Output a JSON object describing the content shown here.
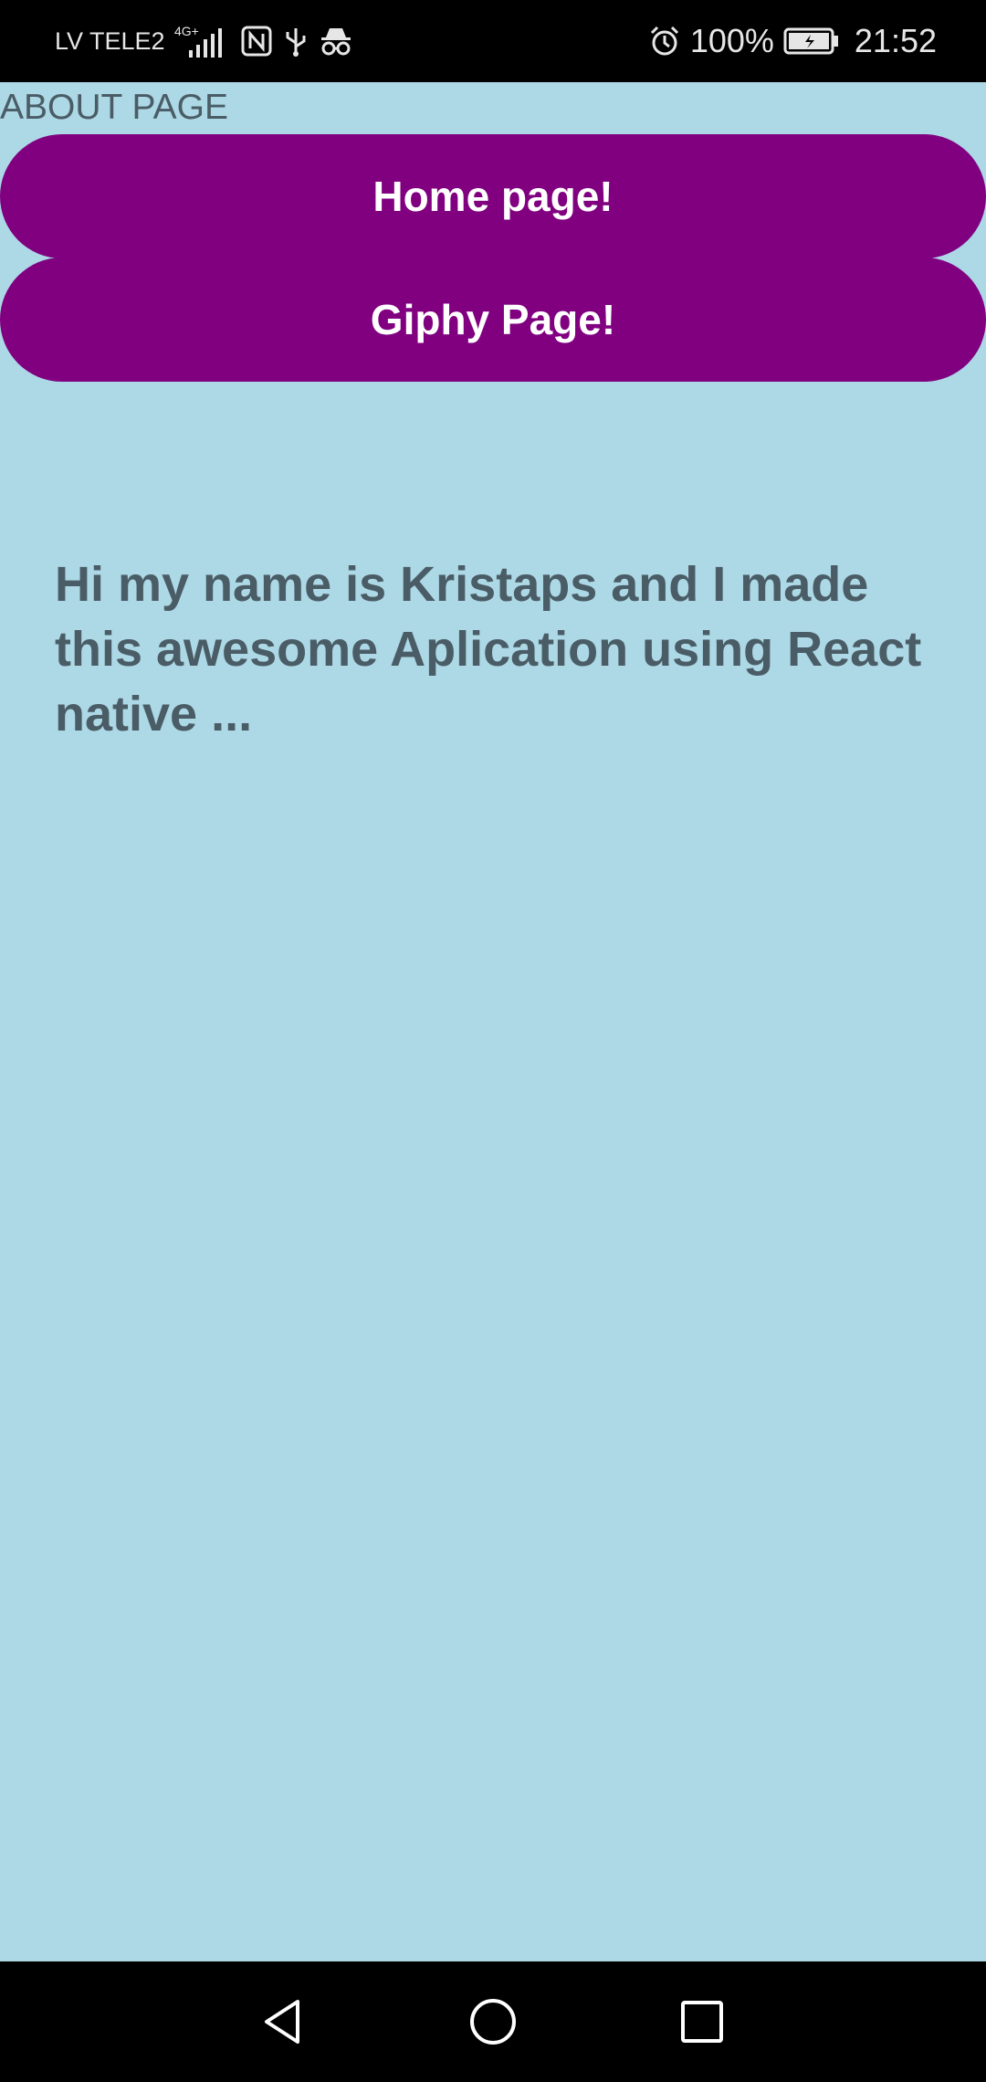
{
  "status_bar": {
    "carrier": "LV TELE2",
    "network": "4G+",
    "battery_percent": "100%",
    "time": "21:52",
    "icons": [
      "signal-icon",
      "nfc-icon",
      "usb-icon",
      "incognito-icon",
      "alarm-icon",
      "battery-charging-icon"
    ]
  },
  "page": {
    "title": "ABOUT PAGE",
    "background_color": "#add8e6",
    "text_color": "#4a5d66"
  },
  "buttons": {
    "home_label": "Home page!",
    "giphy_label": "Giphy Page!",
    "color": "#800080"
  },
  "about": {
    "text": "Hi my name is Kristaps and I made this awesome Aplication using React native ..."
  },
  "nav_bar": {
    "icons": [
      "back-icon",
      "home-icon",
      "recent-apps-icon"
    ]
  }
}
